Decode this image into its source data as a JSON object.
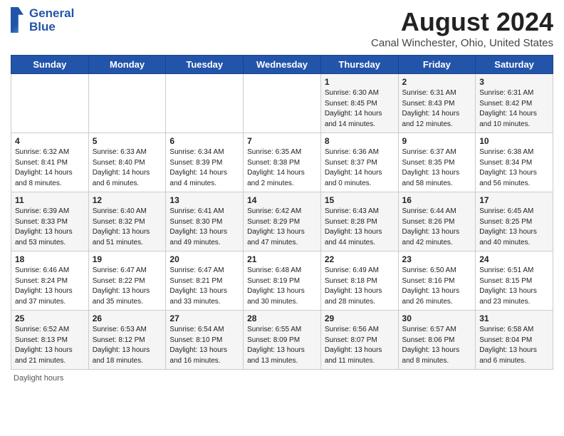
{
  "header": {
    "logo_line1": "General",
    "logo_line2": "Blue",
    "main_title": "August 2024",
    "subtitle": "Canal Winchester, Ohio, United States"
  },
  "days_of_week": [
    "Sunday",
    "Monday",
    "Tuesday",
    "Wednesday",
    "Thursday",
    "Friday",
    "Saturday"
  ],
  "weeks": [
    [
      {
        "day": "",
        "info": ""
      },
      {
        "day": "",
        "info": ""
      },
      {
        "day": "",
        "info": ""
      },
      {
        "day": "",
        "info": ""
      },
      {
        "day": "1",
        "info": "Sunrise: 6:30 AM\nSunset: 8:45 PM\nDaylight: 14 hours and 14 minutes."
      },
      {
        "day": "2",
        "info": "Sunrise: 6:31 AM\nSunset: 8:43 PM\nDaylight: 14 hours and 12 minutes."
      },
      {
        "day": "3",
        "info": "Sunrise: 6:31 AM\nSunset: 8:42 PM\nDaylight: 14 hours and 10 minutes."
      }
    ],
    [
      {
        "day": "4",
        "info": "Sunrise: 6:32 AM\nSunset: 8:41 PM\nDaylight: 14 hours and 8 minutes."
      },
      {
        "day": "5",
        "info": "Sunrise: 6:33 AM\nSunset: 8:40 PM\nDaylight: 14 hours and 6 minutes."
      },
      {
        "day": "6",
        "info": "Sunrise: 6:34 AM\nSunset: 8:39 PM\nDaylight: 14 hours and 4 minutes."
      },
      {
        "day": "7",
        "info": "Sunrise: 6:35 AM\nSunset: 8:38 PM\nDaylight: 14 hours and 2 minutes."
      },
      {
        "day": "8",
        "info": "Sunrise: 6:36 AM\nSunset: 8:37 PM\nDaylight: 14 hours and 0 minutes."
      },
      {
        "day": "9",
        "info": "Sunrise: 6:37 AM\nSunset: 8:35 PM\nDaylight: 13 hours and 58 minutes."
      },
      {
        "day": "10",
        "info": "Sunrise: 6:38 AM\nSunset: 8:34 PM\nDaylight: 13 hours and 56 minutes."
      }
    ],
    [
      {
        "day": "11",
        "info": "Sunrise: 6:39 AM\nSunset: 8:33 PM\nDaylight: 13 hours and 53 minutes."
      },
      {
        "day": "12",
        "info": "Sunrise: 6:40 AM\nSunset: 8:32 PM\nDaylight: 13 hours and 51 minutes."
      },
      {
        "day": "13",
        "info": "Sunrise: 6:41 AM\nSunset: 8:30 PM\nDaylight: 13 hours and 49 minutes."
      },
      {
        "day": "14",
        "info": "Sunrise: 6:42 AM\nSunset: 8:29 PM\nDaylight: 13 hours and 47 minutes."
      },
      {
        "day": "15",
        "info": "Sunrise: 6:43 AM\nSunset: 8:28 PM\nDaylight: 13 hours and 44 minutes."
      },
      {
        "day": "16",
        "info": "Sunrise: 6:44 AM\nSunset: 8:26 PM\nDaylight: 13 hours and 42 minutes."
      },
      {
        "day": "17",
        "info": "Sunrise: 6:45 AM\nSunset: 8:25 PM\nDaylight: 13 hours and 40 minutes."
      }
    ],
    [
      {
        "day": "18",
        "info": "Sunrise: 6:46 AM\nSunset: 8:24 PM\nDaylight: 13 hours and 37 minutes."
      },
      {
        "day": "19",
        "info": "Sunrise: 6:47 AM\nSunset: 8:22 PM\nDaylight: 13 hours and 35 minutes."
      },
      {
        "day": "20",
        "info": "Sunrise: 6:47 AM\nSunset: 8:21 PM\nDaylight: 13 hours and 33 minutes."
      },
      {
        "day": "21",
        "info": "Sunrise: 6:48 AM\nSunset: 8:19 PM\nDaylight: 13 hours and 30 minutes."
      },
      {
        "day": "22",
        "info": "Sunrise: 6:49 AM\nSunset: 8:18 PM\nDaylight: 13 hours and 28 minutes."
      },
      {
        "day": "23",
        "info": "Sunrise: 6:50 AM\nSunset: 8:16 PM\nDaylight: 13 hours and 26 minutes."
      },
      {
        "day": "24",
        "info": "Sunrise: 6:51 AM\nSunset: 8:15 PM\nDaylight: 13 hours and 23 minutes."
      }
    ],
    [
      {
        "day": "25",
        "info": "Sunrise: 6:52 AM\nSunset: 8:13 PM\nDaylight: 13 hours and 21 minutes."
      },
      {
        "day": "26",
        "info": "Sunrise: 6:53 AM\nSunset: 8:12 PM\nDaylight: 13 hours and 18 minutes."
      },
      {
        "day": "27",
        "info": "Sunrise: 6:54 AM\nSunset: 8:10 PM\nDaylight: 13 hours and 16 minutes."
      },
      {
        "day": "28",
        "info": "Sunrise: 6:55 AM\nSunset: 8:09 PM\nDaylight: 13 hours and 13 minutes."
      },
      {
        "day": "29",
        "info": "Sunrise: 6:56 AM\nSunset: 8:07 PM\nDaylight: 13 hours and 11 minutes."
      },
      {
        "day": "30",
        "info": "Sunrise: 6:57 AM\nSunset: 8:06 PM\nDaylight: 13 hours and 8 minutes."
      },
      {
        "day": "31",
        "info": "Sunrise: 6:58 AM\nSunset: 8:04 PM\nDaylight: 13 hours and 6 minutes."
      }
    ]
  ],
  "footer": {
    "label": "Daylight hours"
  }
}
